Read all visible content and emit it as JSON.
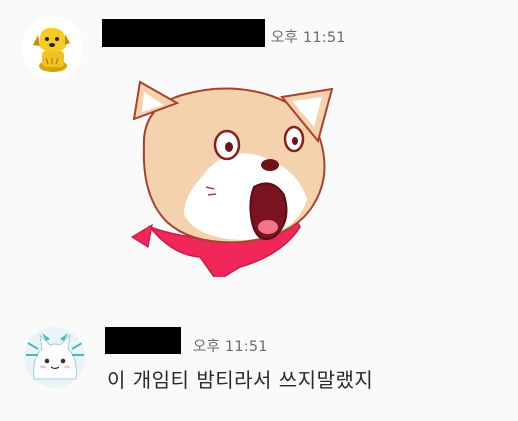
{
  "messages": [
    {
      "time": "오후 11:51",
      "avatar_icon": "yellow-dog-avatar-icon",
      "sticker_icon": "shocked-shiba-dog-sticker-icon"
    },
    {
      "time": "오후 11:51",
      "avatar_icon": "white-cat-avatar-icon",
      "text": "이 개임티 밤티라서 쓰지말랬지"
    }
  ],
  "colors": {
    "background": "#fafafa",
    "timestamp": "#6b6b6b",
    "text": "#2a2a2a",
    "redaction": "#000000",
    "sticker_fur": "#f3d2ad",
    "sticker_scarf": "#f0285a"
  }
}
